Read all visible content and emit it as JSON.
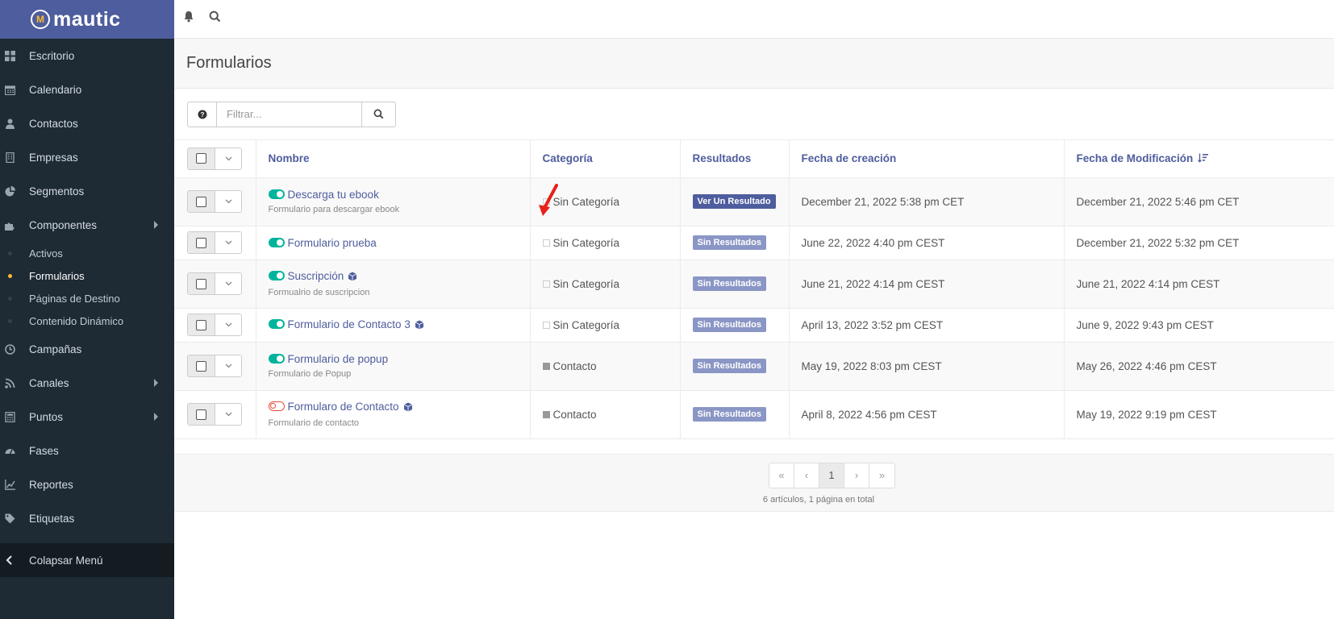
{
  "brand": {
    "name": "mautic"
  },
  "sidebar": {
    "items": [
      {
        "label": "Escritorio",
        "icon": "dashboard-icon"
      },
      {
        "label": "Calendario",
        "icon": "calendar-icon"
      },
      {
        "label": "Contactos",
        "icon": "user-icon"
      },
      {
        "label": "Empresas",
        "icon": "building-icon"
      },
      {
        "label": "Segmentos",
        "icon": "pie-chart-icon"
      },
      {
        "label": "Componentes",
        "icon": "puzzle-icon"
      }
    ],
    "subitems": [
      {
        "label": "Activos"
      },
      {
        "label": "Formularios",
        "active": true
      },
      {
        "label": "Páginas de Destino"
      },
      {
        "label": "Contenido Dinámico"
      }
    ],
    "items2": [
      {
        "label": "Campañas",
        "icon": "clock-icon"
      },
      {
        "label": "Canales",
        "icon": "rss-icon"
      },
      {
        "label": "Puntos",
        "icon": "calculator-icon"
      },
      {
        "label": "Fases",
        "icon": "tachometer-icon"
      },
      {
        "label": "Reportes",
        "icon": "line-chart-icon"
      },
      {
        "label": "Etiquetas",
        "icon": "tag-icon"
      }
    ],
    "collapse_label": "Colapsar Menú"
  },
  "header": {
    "title": "Formularios"
  },
  "filter": {
    "placeholder": "Filtrar..."
  },
  "table": {
    "columns": {
      "name": "Nombre",
      "category": "Categoría",
      "results": "Resultados",
      "created": "Fecha de creación",
      "modified": "Fecha de Modificación"
    },
    "rows": [
      {
        "name": "Descarga tu ebook",
        "description": "Formulario para descargar ebook",
        "published": true,
        "cube": false,
        "category": "Sin Categoría",
        "category_filled": false,
        "results": "Ver Un Resultado",
        "results_primary": true,
        "created": "December 21, 2022 5:38 pm CET",
        "modified": "December 21, 2022 5:46 pm CET"
      },
      {
        "name": "Formulario prueba",
        "description": "",
        "published": true,
        "cube": false,
        "category": "Sin Categoría",
        "category_filled": false,
        "results": "Sin Resultados",
        "results_primary": false,
        "created": "June 22, 2022 4:40 pm CEST",
        "modified": "December 21, 2022 5:32 pm CET"
      },
      {
        "name": "Suscripción",
        "description": "Formualrio de suscripcion",
        "published": true,
        "cube": true,
        "category": "Sin Categoría",
        "category_filled": false,
        "results": "Sin Resultados",
        "results_primary": false,
        "created": "June 21, 2022 4:14 pm CEST",
        "modified": "June 21, 2022 4:14 pm CEST"
      },
      {
        "name": "Formulario de Contacto 3",
        "description": "",
        "published": true,
        "cube": true,
        "category": "Sin Categoría",
        "category_filled": false,
        "results": "Sin Resultados",
        "results_primary": false,
        "created": "April 13, 2022 3:52 pm CEST",
        "modified": "June 9, 2022 9:43 pm CEST"
      },
      {
        "name": "Formulario de popup",
        "description": "Formulario de Popup",
        "published": true,
        "cube": false,
        "category": "Contacto",
        "category_filled": true,
        "results": "Sin Resultados",
        "results_primary": false,
        "created": "May 19, 2022 8:03 pm CEST",
        "modified": "May 26, 2022 4:46 pm CEST"
      },
      {
        "name": "Formularo de Contacto",
        "description": "Formulario de contacto",
        "published": false,
        "cube": true,
        "category": "Contacto",
        "category_filled": true,
        "results": "Sin Resultados",
        "results_primary": false,
        "created": "April 8, 2022 4:56 pm CEST",
        "modified": "May 19, 2022 9:19 pm CEST"
      }
    ]
  },
  "pagination": {
    "first": "«",
    "prev": "‹",
    "current": "1",
    "next": "›",
    "last": "»",
    "info": "6 artículos, 1 página en total"
  },
  "colors": {
    "sidebar_bg": "#1e2a34",
    "brand_bg": "#4e5d9d",
    "accent": "#4e5d9d",
    "active_dot": "#fdb933",
    "toggle_on": "#00b49c",
    "toggle_off": "#e74c3c",
    "annotation_arrow": "#e8201a"
  }
}
